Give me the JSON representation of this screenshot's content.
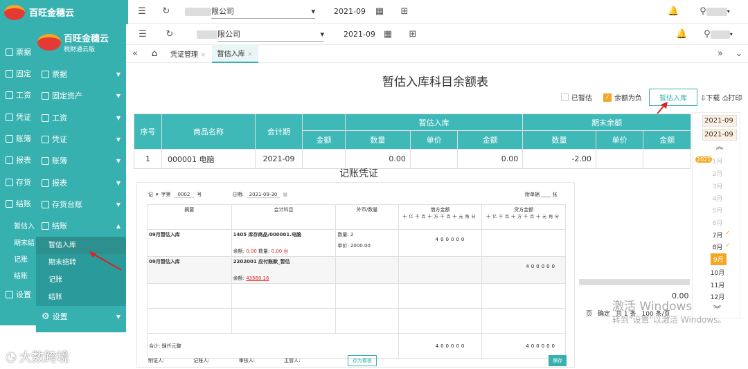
{
  "back_window": {
    "brand": "百旺金穗云",
    "brand_sub": "税",
    "company": "限公司",
    "period": "2021-09",
    "sidebar": [
      "票据",
      "固定",
      "工资",
      "凭证",
      "账簿",
      "报表",
      "存货",
      "结账",
      "暂估入",
      "期末结",
      "记账",
      "结账",
      "设置"
    ]
  },
  "front_window": {
    "brand": "百旺金穗云",
    "brand_sub": "税财通云版",
    "company": "限公司",
    "period": "2021-09",
    "sidebar": {
      "items": [
        "票据",
        "固定资产",
        "工资",
        "凭证",
        "账簿",
        "报表",
        "存货台账",
        "结账"
      ],
      "sub_items": [
        "暂估入库",
        "期末结转",
        "记账",
        "结账"
      ],
      "settings": "设置"
    },
    "tabs": {
      "home": "⌂",
      "t1": "凭证管理",
      "t2": "暂估入库"
    },
    "page_title": "暂估入库科目余额表",
    "toolbar": {
      "chk1": "已暂估",
      "chk2": "余额为负",
      "btn": "暂估入库",
      "download": "下载",
      "print": "打印"
    },
    "table": {
      "h_no": "序号",
      "h_name": "商品名称",
      "h_period": "会计期",
      "h_in": "暂估入库",
      "h_end": "期末余额",
      "h_amount": "金额",
      "h_qty": "数量",
      "h_price": "单价",
      "row": {
        "no": "1",
        "name": "000001 电脑",
        "period": "2021-09",
        "qty": "0.00",
        "amount": "0.00",
        "end_qty": "-2.00"
      }
    },
    "footer": {
      "total": "0.00",
      "page_label": "页",
      "confirm": "确定",
      "count": "共 1 条",
      "per_page": "100 条/页"
    }
  },
  "voucher": {
    "title": "记账凭证",
    "word": "记",
    "word_label": "字第",
    "number": "0002",
    "number_suffix": "号",
    "date_label": "日期:",
    "date": "2021-09-30",
    "attach_label": "附单据",
    "attach_suffix": "张",
    "headers": {
      "summary": "摘要",
      "account": "会计科目",
      "qty": "外币/数量",
      "debit": "借方金额",
      "credit": "贷方金额"
    },
    "digit_units": "十亿千百十万千百十元角分",
    "rows": [
      {
        "summary": "09月暂估入库",
        "account": "1405 库存商品/000001.电脑",
        "balance_label": "余额:",
        "balance": "0.00",
        "qty_label": "数量:",
        "qty_val": "0.00 台",
        "mid1": "数量: 2",
        "mid2": "单价: 2000.00",
        "debit": "400000",
        "credit": ""
      },
      {
        "summary": "09月暂估入库",
        "account": "2202001 应付账款_暂估",
        "balance_label": "余额:",
        "balance": "43560.16",
        "debit": "",
        "credit": "400000"
      }
    ],
    "total_label": "合计: 肆仟元整",
    "total_debit": "400000",
    "total_credit": "400000",
    "footer": {
      "maker": "制证人:",
      "bookkeeper": "记账人:",
      "auditor": "审核人:",
      "supervisor": "主管人:",
      "template_btn": "存为模板",
      "save_btn": "保存"
    }
  },
  "calendar": {
    "from": "2021-09",
    "to": "2021-09",
    "year_badge": "2021",
    "months": [
      "1月",
      "2月",
      "3月",
      "4月",
      "5月",
      "6月",
      "7月",
      "8月",
      "9月",
      "10月",
      "11月",
      "12月"
    ]
  },
  "watermark": {
    "line1": "激活 Windows",
    "line2": "转到\"设置\"以激活 Windows。"
  },
  "logo_text": "大数跨境",
  "colors": {
    "teal": "#37b0b0",
    "orange": "#f5a623",
    "red": "#e02020"
  }
}
